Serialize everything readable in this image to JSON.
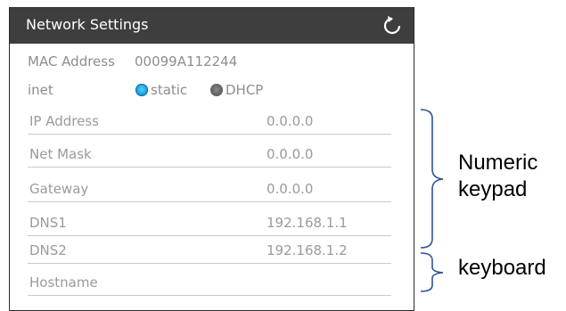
{
  "window": {
    "title": "Network Settings",
    "refresh_icon": "refresh-icon"
  },
  "device": {
    "mac_label": "MAC Address",
    "mac_value": "00099A112244",
    "inet_label": "inet",
    "inet_options": [
      {
        "label": "static",
        "selected": true
      },
      {
        "label": "DHCP",
        "selected": false
      }
    ]
  },
  "fields": [
    {
      "label": "IP Address",
      "value": "0.0.0.0"
    },
    {
      "label": "Net Mask",
      "value": "0.0.0.0"
    },
    {
      "label": "Gateway",
      "value": "0.0.0.0"
    },
    {
      "label": "DNS1",
      "value": "192.168.1.1"
    },
    {
      "label": "DNS2",
      "value": "192.168.1.2"
    },
    {
      "label": "Hostname",
      "value": ""
    }
  ],
  "annotations": {
    "numeric_keypad": "Numeric\nkeypad",
    "keyboard": "keyboard",
    "bracket_color": "#2f5597"
  },
  "colors": {
    "titlebar": "#3e3e3e",
    "radio_selected": "#1d9fe0",
    "text": "#8d8d8d"
  }
}
